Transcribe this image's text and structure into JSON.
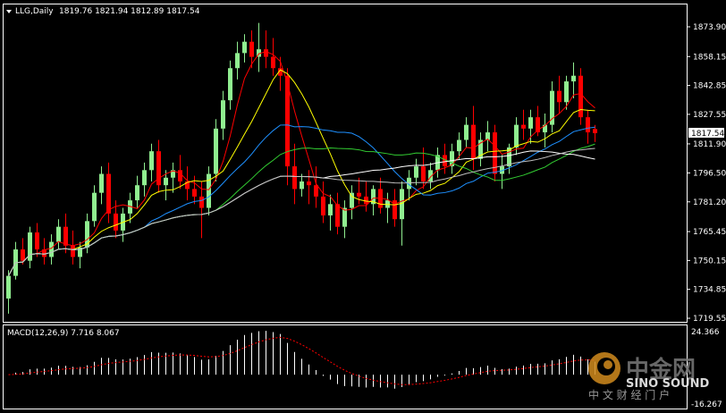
{
  "header": {
    "arrow_icon": "dropdown-arrow-icon",
    "symbol": "LLG,Daily",
    "ohlc": "1819.76 1821.94 1812.89 1817.54"
  },
  "price_axis": {
    "ticks": [
      "1873.90",
      "1858.15",
      "1842.85",
      "1827.55",
      "1811.90",
      "1796.50",
      "1781.20",
      "1765.45",
      "1750.15",
      "1734.85",
      "1719.55"
    ],
    "current_price": "1817.54",
    "current_price_color": "#ffffff"
  },
  "macd": {
    "label": "MACD(12,26,9) 7.716 8.067",
    "axis_top": "24.366",
    "axis_bottom": "-16.267"
  },
  "colors": {
    "bull": "#90ee90",
    "bear": "#ff0000",
    "ma_fast": "#ffff00",
    "ma_red": "#ff0000",
    "ma_blue": "#1e90ff",
    "ma_green": "#32cd32",
    "ma_white": "#ffffff",
    "ma_gray": "#c0c0c0",
    "macd_hist": "#ffffff",
    "macd_signal": "#ff0000",
    "grid": "#ffffff"
  },
  "watermark": {
    "logo_icon": "sino-sound-logo-icon",
    "cn_name": "中金网",
    "en_name": "SINO SOUND",
    "cn_tagline": "中 文 财 经 门 户"
  },
  "chart_data": {
    "type": "candlestick",
    "symbol": "LLG",
    "timeframe": "Daily",
    "ylim": [
      1719.55,
      1873.9
    ],
    "candles": [
      [
        1730,
        1745,
        1722,
        1742
      ],
      [
        1742,
        1760,
        1740,
        1756
      ],
      [
        1756,
        1762,
        1748,
        1750
      ],
      [
        1750,
        1768,
        1746,
        1765
      ],
      [
        1765,
        1770,
        1752,
        1756
      ],
      [
        1756,
        1762,
        1748,
        1752
      ],
      [
        1752,
        1764,
        1748,
        1760
      ],
      [
        1760,
        1772,
        1756,
        1768
      ],
      [
        1768,
        1775,
        1754,
        1758
      ],
      [
        1758,
        1766,
        1748,
        1752
      ],
      [
        1752,
        1760,
        1746,
        1757
      ],
      [
        1757,
        1775,
        1754,
        1771
      ],
      [
        1771,
        1790,
        1768,
        1786
      ],
      [
        1786,
        1800,
        1780,
        1796
      ],
      [
        1796,
        1802,
        1770,
        1775
      ],
      [
        1775,
        1782,
        1762,
        1766
      ],
      [
        1766,
        1778,
        1760,
        1775
      ],
      [
        1775,
        1786,
        1770,
        1782
      ],
      [
        1782,
        1795,
        1778,
        1790
      ],
      [
        1790,
        1802,
        1784,
        1798
      ],
      [
        1798,
        1812,
        1792,
        1808
      ],
      [
        1808,
        1814,
        1786,
        1790
      ],
      [
        1790,
        1798,
        1782,
        1794
      ],
      [
        1794,
        1802,
        1786,
        1798
      ],
      [
        1798,
        1806,
        1788,
        1792
      ],
      [
        1792,
        1800,
        1782,
        1788
      ],
      [
        1788,
        1795,
        1780,
        1784
      ],
      [
        1784,
        1792,
        1762,
        1778
      ],
      [
        1778,
        1800,
        1774,
        1796
      ],
      [
        1796,
        1825,
        1792,
        1820
      ],
      [
        1820,
        1840,
        1814,
        1835
      ],
      [
        1835,
        1856,
        1830,
        1852
      ],
      [
        1852,
        1866,
        1846,
        1860
      ],
      [
        1860,
        1870,
        1855,
        1866
      ],
      [
        1866,
        1872,
        1852,
        1858
      ],
      [
        1858,
        1876,
        1850,
        1862
      ],
      [
        1862,
        1872,
        1852,
        1858
      ],
      [
        1858,
        1868,
        1848,
        1852
      ],
      [
        1852,
        1858,
        1840,
        1848
      ],
      [
        1848,
        1852,
        1790,
        1800
      ],
      [
        1800,
        1812,
        1780,
        1788
      ],
      [
        1788,
        1796,
        1784,
        1792
      ],
      [
        1792,
        1798,
        1780,
        1790
      ],
      [
        1790,
        1800,
        1778,
        1784
      ],
      [
        1784,
        1792,
        1770,
        1774
      ],
      [
        1774,
        1785,
        1766,
        1780
      ],
      [
        1780,
        1786,
        1764,
        1768
      ],
      [
        1768,
        1782,
        1762,
        1778
      ],
      [
        1778,
        1790,
        1772,
        1786
      ],
      [
        1786,
        1794,
        1780,
        1784
      ],
      [
        1784,
        1792,
        1776,
        1780
      ],
      [
        1780,
        1790,
        1774,
        1788
      ],
      [
        1788,
        1794,
        1775,
        1778
      ],
      [
        1778,
        1786,
        1770,
        1782
      ],
      [
        1782,
        1788,
        1768,
        1772
      ],
      [
        1772,
        1792,
        1758,
        1788
      ],
      [
        1788,
        1798,
        1782,
        1794
      ],
      [
        1794,
        1804,
        1790,
        1800
      ],
      [
        1800,
        1810,
        1788,
        1792
      ],
      [
        1792,
        1802,
        1788,
        1798
      ],
      [
        1798,
        1810,
        1794,
        1806
      ],
      [
        1806,
        1812,
        1796,
        1800
      ],
      [
        1800,
        1812,
        1796,
        1808
      ],
      [
        1808,
        1818,
        1804,
        1814
      ],
      [
        1814,
        1826,
        1810,
        1822
      ],
      [
        1822,
        1832,
        1798,
        1804
      ],
      [
        1804,
        1818,
        1800,
        1814
      ],
      [
        1814,
        1824,
        1808,
        1818
      ],
      [
        1818,
        1822,
        1792,
        1796
      ],
      [
        1796,
        1806,
        1788,
        1800
      ],
      [
        1800,
        1812,
        1796,
        1810
      ],
      [
        1810,
        1826,
        1806,
        1822
      ],
      [
        1822,
        1830,
        1814,
        1820
      ],
      [
        1820,
        1830,
        1812,
        1826
      ],
      [
        1826,
        1832,
        1816,
        1818
      ],
      [
        1818,
        1828,
        1810,
        1822
      ],
      [
        1822,
        1845,
        1818,
        1840
      ],
      [
        1840,
        1848,
        1828,
        1834
      ],
      [
        1834,
        1848,
        1830,
        1845
      ],
      [
        1845,
        1855,
        1836,
        1848
      ],
      [
        1848,
        1852,
        1822,
        1826
      ],
      [
        1826,
        1830,
        1812,
        1818
      ],
      [
        1819.76,
        1821.94,
        1812.89,
        1817.54
      ]
    ],
    "macd": {
      "ylim": [
        -16.267,
        24.366
      ],
      "label": "MACD(12,26,9)",
      "main": 7.716,
      "signal": 8.067
    }
  }
}
